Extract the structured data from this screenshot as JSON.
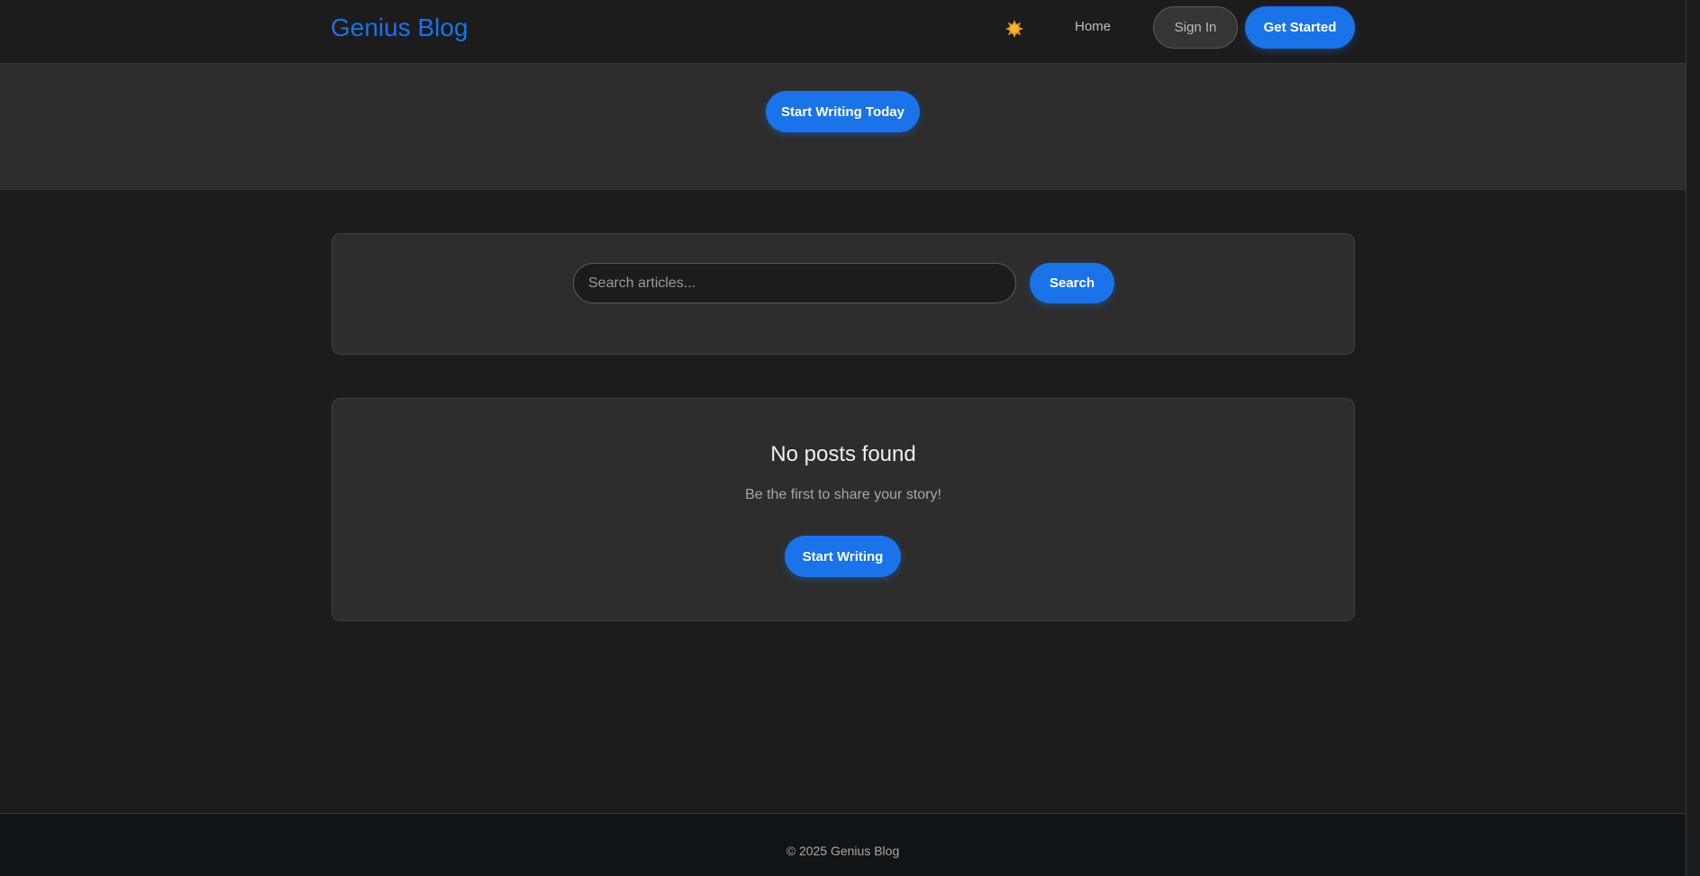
{
  "nav": {
    "brand": "Genius Blog",
    "theme_icon": "sun-icon",
    "home_label": "Home",
    "signin_label": "Sign In",
    "get_started_label": "Get Started"
  },
  "hero": {
    "cta_label": "Start Writing Today"
  },
  "search": {
    "placeholder": "Search articles...",
    "value": "",
    "button_label": "Search"
  },
  "empty_state": {
    "title": "No posts found",
    "subtitle": "Be the first to share your story!",
    "button_label": "Start Writing"
  },
  "footer": {
    "text": "© 2025 Genius Blog"
  },
  "colors": {
    "accent": "#1a73e8",
    "background": "#1c1c1c",
    "card": "#2d2d2d",
    "footer": "#111417",
    "sun": "#f5a623"
  }
}
